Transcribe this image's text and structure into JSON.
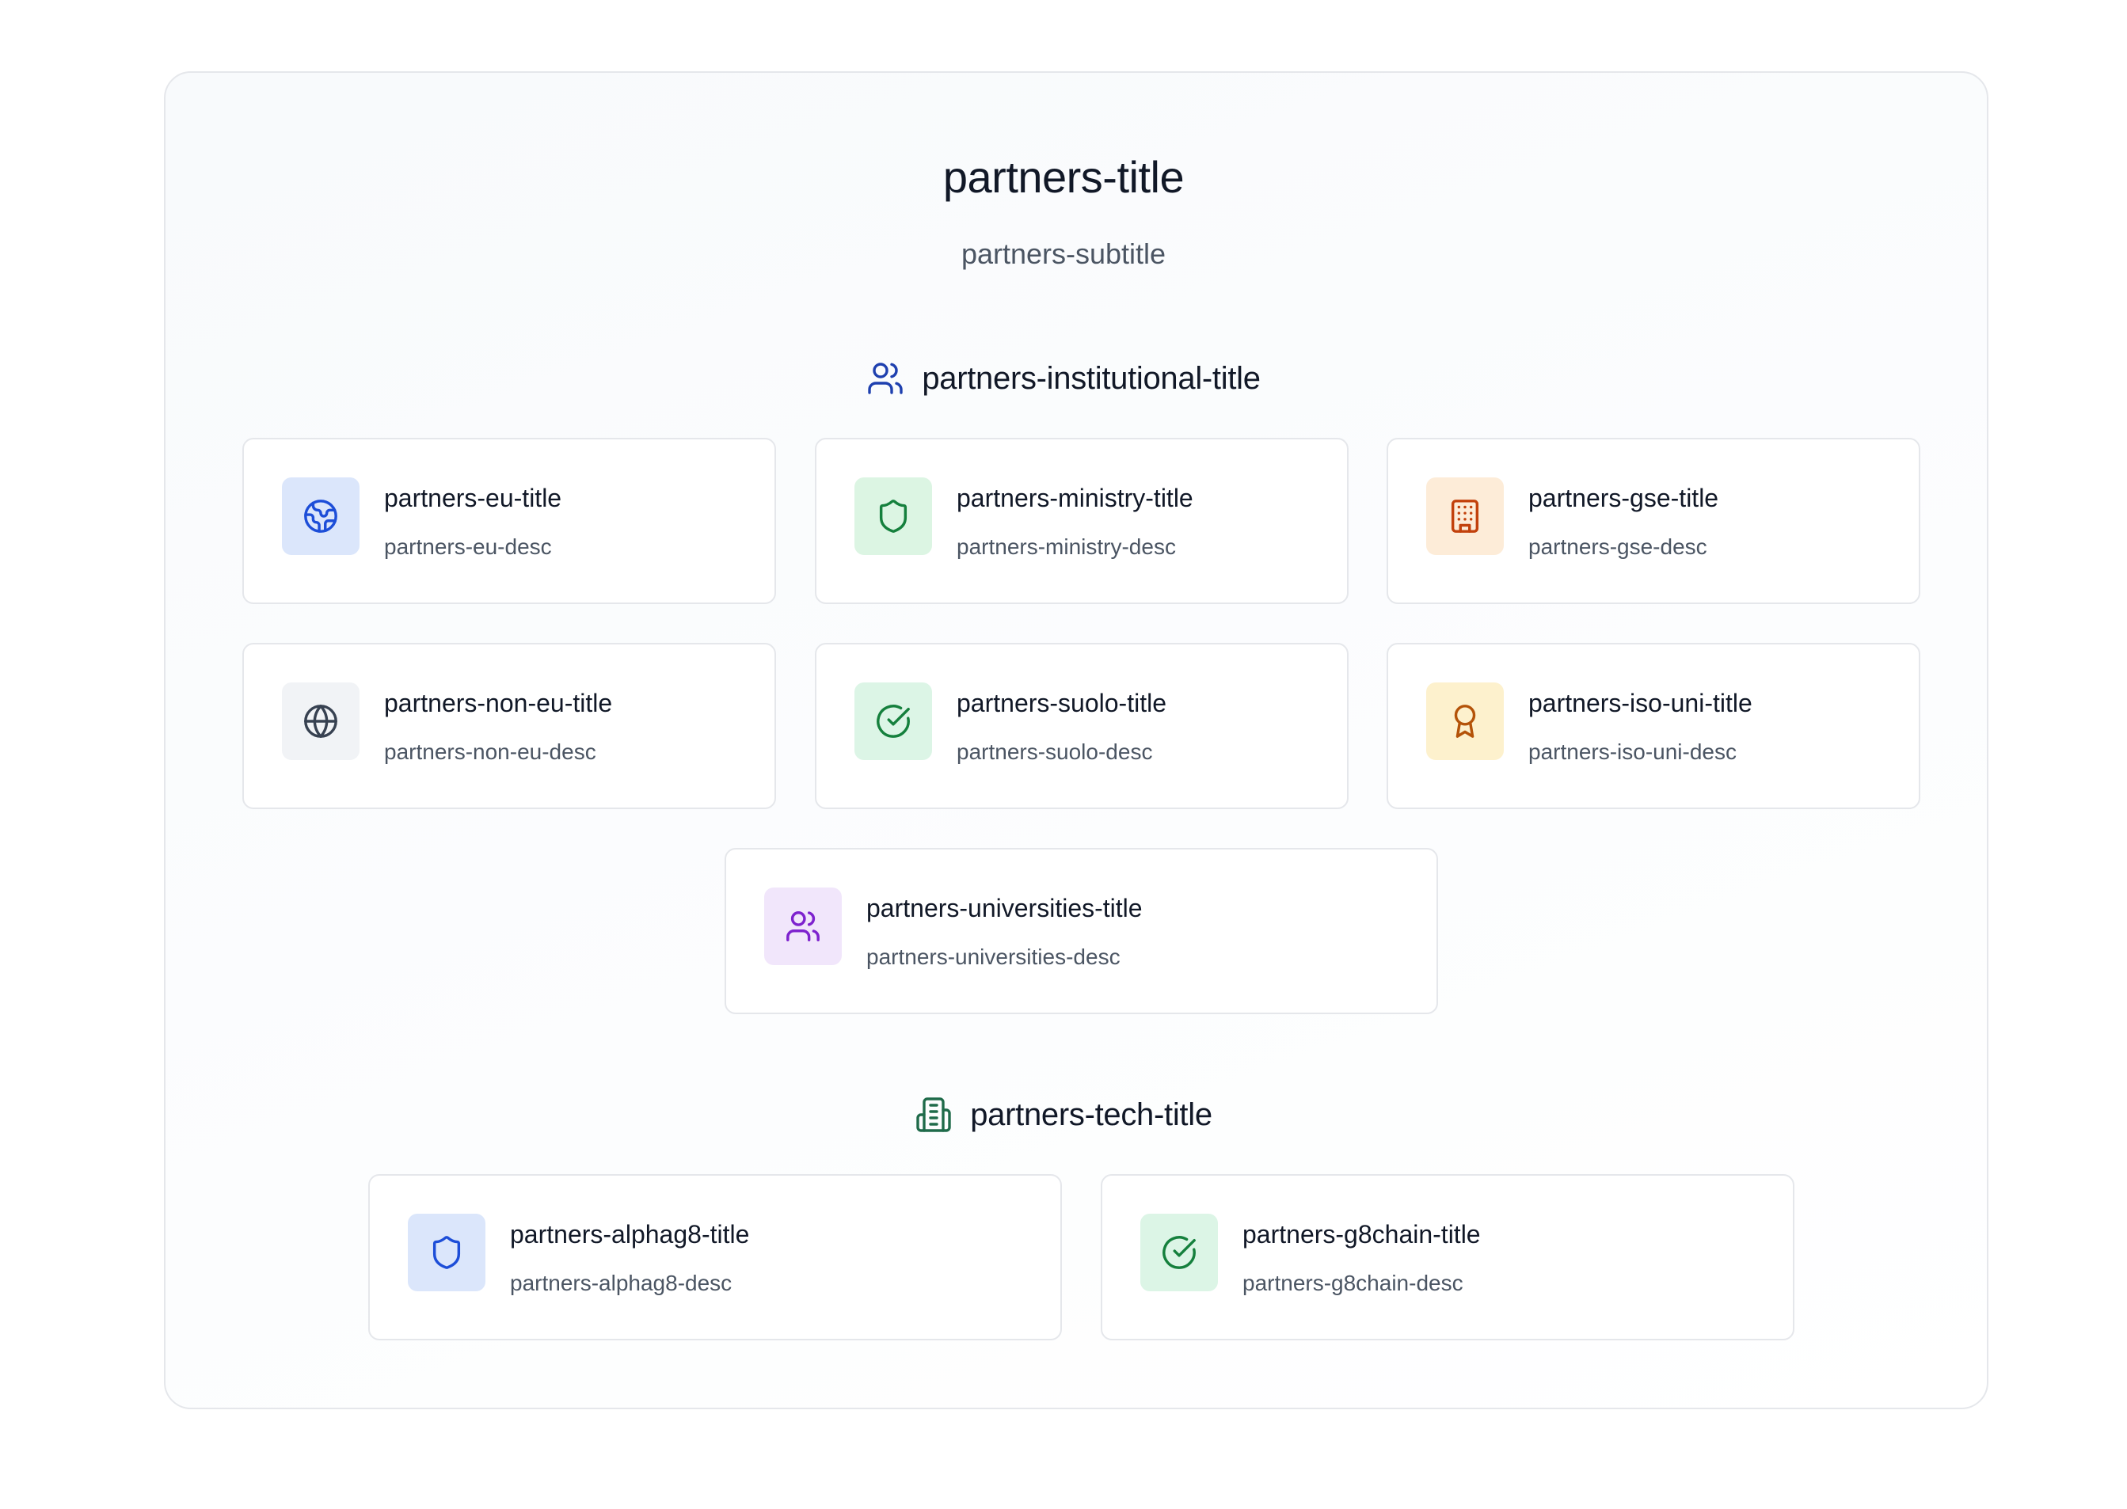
{
  "header": {
    "title": "partners-title",
    "subtitle": "partners-subtitle"
  },
  "sections": [
    {
      "title": "partners-institutional-title",
      "icon": "users-icon",
      "icon_color": "#1e40af",
      "cards": [
        {
          "title": "partners-eu-title",
          "desc": "partners-eu-desc",
          "icon": "globe-map-icon",
          "icon_color": "#1d4ed8",
          "icon_bg": "#dbe6fb"
        },
        {
          "title": "partners-ministry-title",
          "desc": "partners-ministry-desc",
          "icon": "shield-icon",
          "icon_color": "#15803d",
          "icon_bg": "#dcf5e3"
        },
        {
          "title": "partners-gse-title",
          "desc": "partners-gse-desc",
          "icon": "building-icon",
          "icon_color": "#c2410c",
          "icon_bg": "#fdecd8"
        },
        {
          "title": "partners-non-eu-title",
          "desc": "partners-non-eu-desc",
          "icon": "globe-icon",
          "icon_color": "#374151",
          "icon_bg": "#f1f3f6"
        },
        {
          "title": "partners-suolo-title",
          "desc": "partners-suolo-desc",
          "icon": "check-circle-icon",
          "icon_color": "#15803d",
          "icon_bg": "#dcf5e6"
        },
        {
          "title": "partners-iso-uni-title",
          "desc": "partners-iso-uni-desc",
          "icon": "award-icon",
          "icon_color": "#b45309",
          "icon_bg": "#fdf1cd"
        },
        {
          "title": "partners-universities-title",
          "desc": "partners-universities-desc",
          "icon": "users-icon",
          "icon_color": "#7e22ce",
          "icon_bg": "#f1e6fb"
        }
      ]
    },
    {
      "title": "partners-tech-title",
      "icon": "building-icon",
      "icon_color": "#1f6b4a",
      "cards": [
        {
          "title": "partners-alphag8-title",
          "desc": "partners-alphag8-desc",
          "icon": "shield-icon",
          "icon_color": "#1d4ed8",
          "icon_bg": "#dbe6fb"
        },
        {
          "title": "partners-g8chain-title",
          "desc": "partners-g8chain-desc",
          "icon": "check-circle-icon",
          "icon_color": "#15803d",
          "icon_bg": "#dcf5e6"
        }
      ]
    }
  ]
}
